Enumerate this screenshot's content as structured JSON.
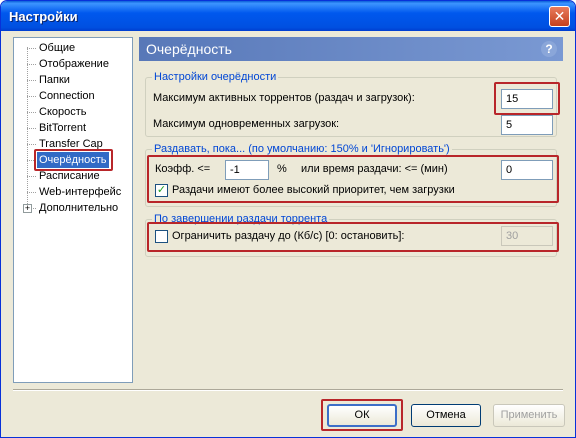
{
  "window": {
    "title": "Настройки",
    "close_glyph": "✕"
  },
  "tree": {
    "items": [
      {
        "label": "Общие"
      },
      {
        "label": "Отображение"
      },
      {
        "label": "Папки"
      },
      {
        "label": "Connection"
      },
      {
        "label": "Скорость"
      },
      {
        "label": "BitTorrent"
      },
      {
        "label": "Transfer Cap"
      },
      {
        "label": "Очерёдность",
        "selected": true
      },
      {
        "label": "Расписание"
      },
      {
        "label": "Web-интерфейс"
      },
      {
        "label": "Дополнительно",
        "expandable": true
      }
    ],
    "expander_glyph": "+"
  },
  "panel": {
    "title": "Очерёдность",
    "help_glyph": "?",
    "queue_settings": {
      "title": "Настройки очерёдности",
      "max_active_label": "Максимум активных торрентов (раздач и загрузок):",
      "max_active_value": "15",
      "max_downloads_label": "Максимум одновременных загрузок:",
      "max_downloads_value": "5"
    },
    "seed_while": {
      "title": "Раздавать, пока... (по умолчанию: 150% и 'Игнорировать')",
      "ratio_label": "Коэфф. <=",
      "ratio_value": "-1",
      "percent": "%",
      "time_label": "или время раздачи: <= (мин)",
      "time_value": "0",
      "priority_checkbox_label": "Раздачи имеют более высокий приоритет, чем загрузки",
      "priority_checked": true,
      "check_glyph": "✓"
    },
    "on_finish": {
      "title": "По завершении раздачи торрента",
      "limit_label": "Ограничить раздачу до (Кб/с) [0: остановить]:",
      "limit_checked": false,
      "limit_value": "30"
    }
  },
  "buttons": {
    "ok": "ОК",
    "cancel": "Отмена",
    "apply": "Применить"
  },
  "colors": {
    "highlight": "#b8262a",
    "accent": "#0046d5",
    "header": "#6a8cc8"
  }
}
